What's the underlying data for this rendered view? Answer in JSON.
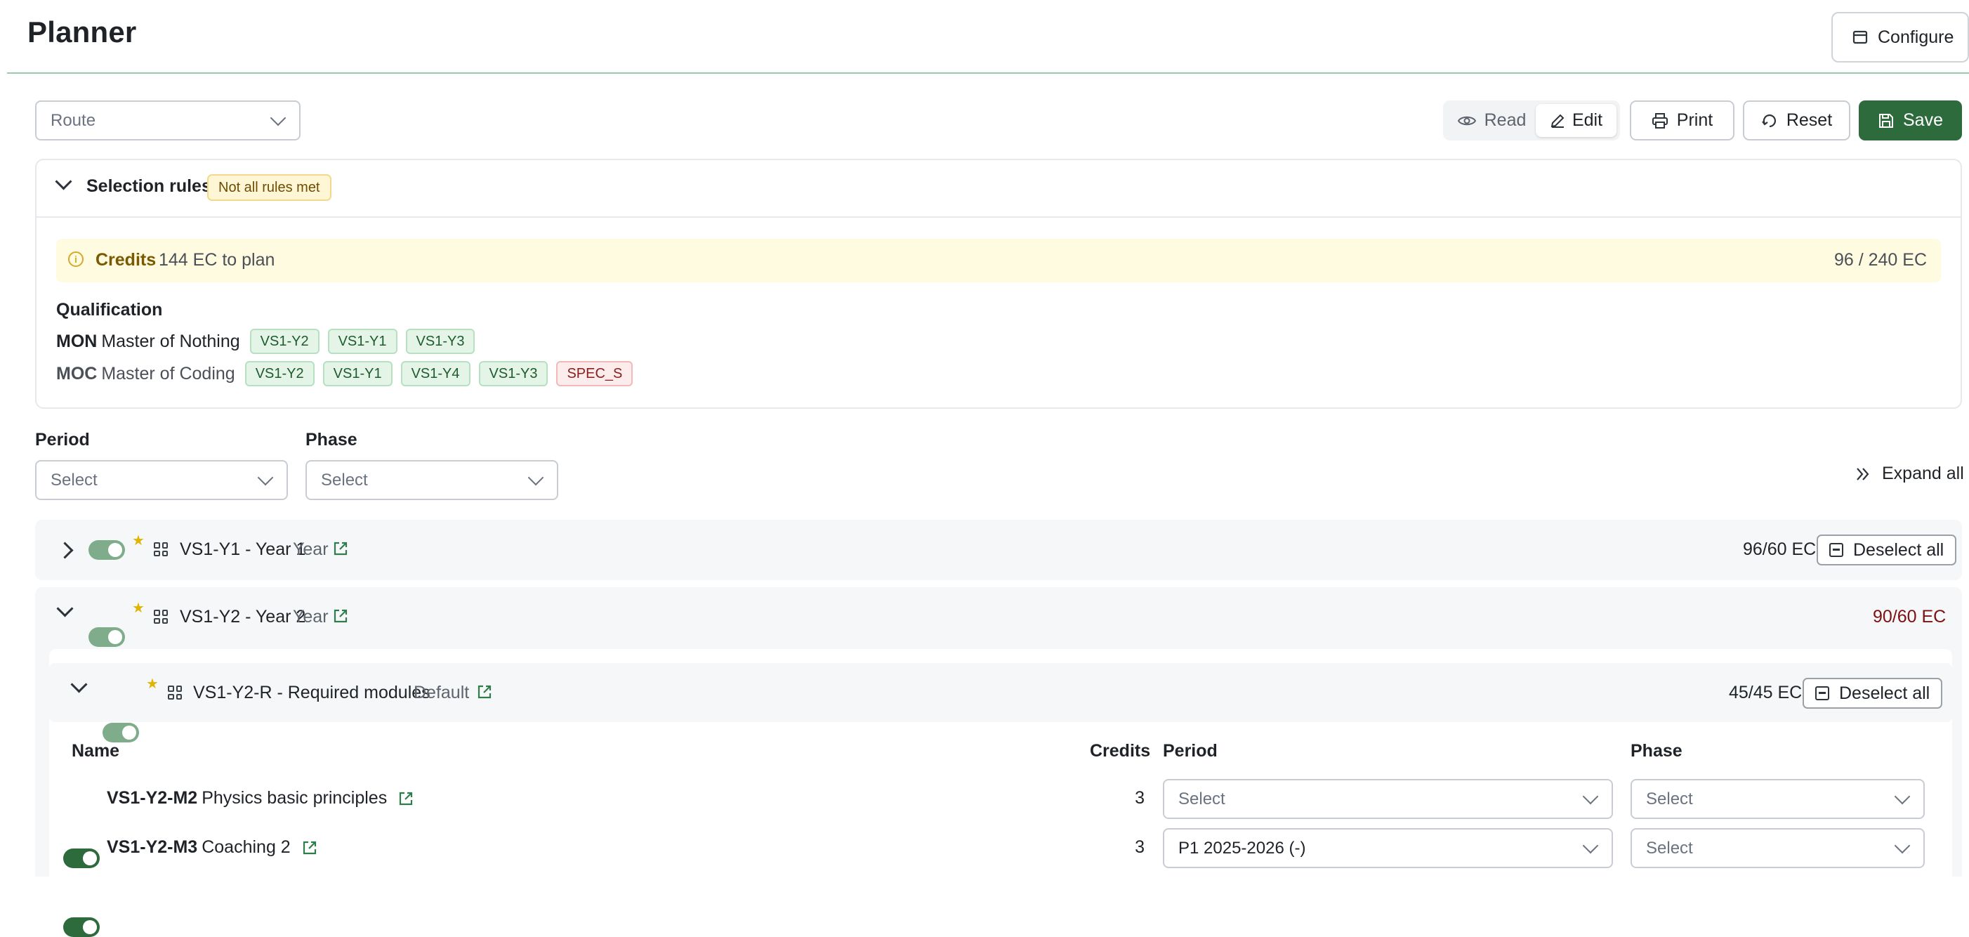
{
  "header": {
    "title": "Planner",
    "configure_label": "Configure"
  },
  "toolbar": {
    "route_placeholder": "Route",
    "read_label": "Read",
    "edit_label": "Edit",
    "print_label": "Print",
    "reset_label": "Reset",
    "save_label": "Save"
  },
  "rules": {
    "title": "Selection rules",
    "status_badge": "Not all rules met",
    "credits_label": "Credits",
    "credits_text": "144 EC to plan",
    "credits_total": "96 / 240 EC",
    "qualification_heading": "Qualification",
    "qualifications": [
      {
        "code": "MON",
        "name": "Master of Nothing",
        "tags": [
          {
            "label": "VS1-Y2",
            "status": "met"
          },
          {
            "label": "VS1-Y1",
            "status": "met"
          },
          {
            "label": "VS1-Y3",
            "status": "met"
          }
        ]
      },
      {
        "code": "MOC",
        "name": "Master of Coding",
        "tags": [
          {
            "label": "VS1-Y2",
            "status": "met"
          },
          {
            "label": "VS1-Y1",
            "status": "met"
          },
          {
            "label": "VS1-Y4",
            "status": "met"
          },
          {
            "label": "VS1-Y3",
            "status": "met"
          },
          {
            "label": "SPEC_S",
            "status": "unmet"
          }
        ]
      }
    ]
  },
  "filters": {
    "period_label": "Period",
    "period_placeholder": "Select",
    "phase_label": "Phase",
    "phase_placeholder": "Select",
    "expand_all_label": "Expand all"
  },
  "groups": [
    {
      "code": "VS1-Y1 - Year 1",
      "type": "Year",
      "ec": "96/60 EC",
      "deselect_label": "Deselect all",
      "expanded": false,
      "enabled": true
    },
    {
      "code": "VS1-Y2 - Year 2",
      "type": "Year",
      "ec": "90/60 EC",
      "ec_color": "#7d1010",
      "expanded": true,
      "enabled": true
    }
  ],
  "subgroup": {
    "code": "VS1-Y2-R - Required modules",
    "type": "Default",
    "ec": "45/45 EC",
    "deselect_label": "Deselect all",
    "columns": {
      "name": "Name",
      "credits": "Credits",
      "period": "Period",
      "phase": "Phase"
    },
    "modules": [
      {
        "code": "VS1-Y2-M2",
        "name": "Physics basic principles",
        "credits": "3",
        "period": "Select",
        "phase": "Select",
        "enabled": true
      },
      {
        "code": "VS1-Y2-M3",
        "name": "Coaching 2",
        "credits": "3",
        "period": "P1 2025-2026 (-)",
        "phase": "Select",
        "enabled": true
      }
    ]
  },
  "colors": {
    "accent": "#2e6b3c",
    "warn_bg": "#fffbe0",
    "over_limit": "#7d1010"
  }
}
